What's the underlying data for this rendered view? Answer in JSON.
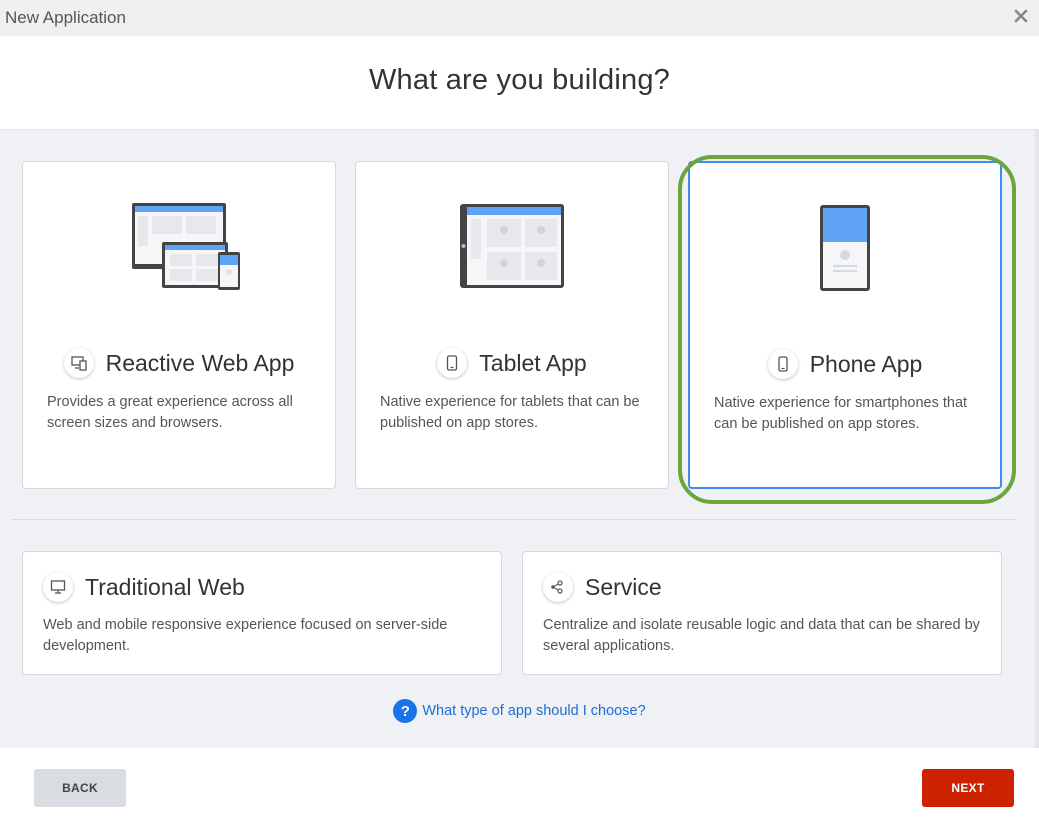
{
  "window": {
    "title": "New Application"
  },
  "heading": "What are you building?",
  "cards": [
    {
      "id": "reactive",
      "title": "Reactive Web App",
      "desc": "Provides a great experience across all screen sizes and browsers.",
      "icon": "devices-icon"
    },
    {
      "id": "tablet",
      "title": "Tablet App",
      "desc": "Native experience for tablets that can be published on app stores.",
      "icon": "tablet-icon"
    },
    {
      "id": "phone",
      "title": "Phone App",
      "desc": "Native experience for smartphones that can be published on app stores.",
      "icon": "phone-icon",
      "selected": true
    }
  ],
  "wide_cards": [
    {
      "id": "traditional",
      "title": "Traditional Web",
      "desc": "Web and mobile responsive experience focused on server-side development.",
      "icon": "monitor-icon"
    },
    {
      "id": "service",
      "title": "Service",
      "desc": "Centralize and isolate reusable logic and data that can be shared by several applications.",
      "icon": "service-nodes-icon"
    }
  ],
  "help": {
    "icon": "question-icon",
    "link": "What type of app should I choose?"
  },
  "buttons": {
    "back": "BACK",
    "next": "NEXT"
  },
  "colors": {
    "accent_blue": "#3d8bf5",
    "next_red": "#cc2200",
    "highlight_green": "#6aa63d",
    "content_bg": "#eff1f4"
  }
}
